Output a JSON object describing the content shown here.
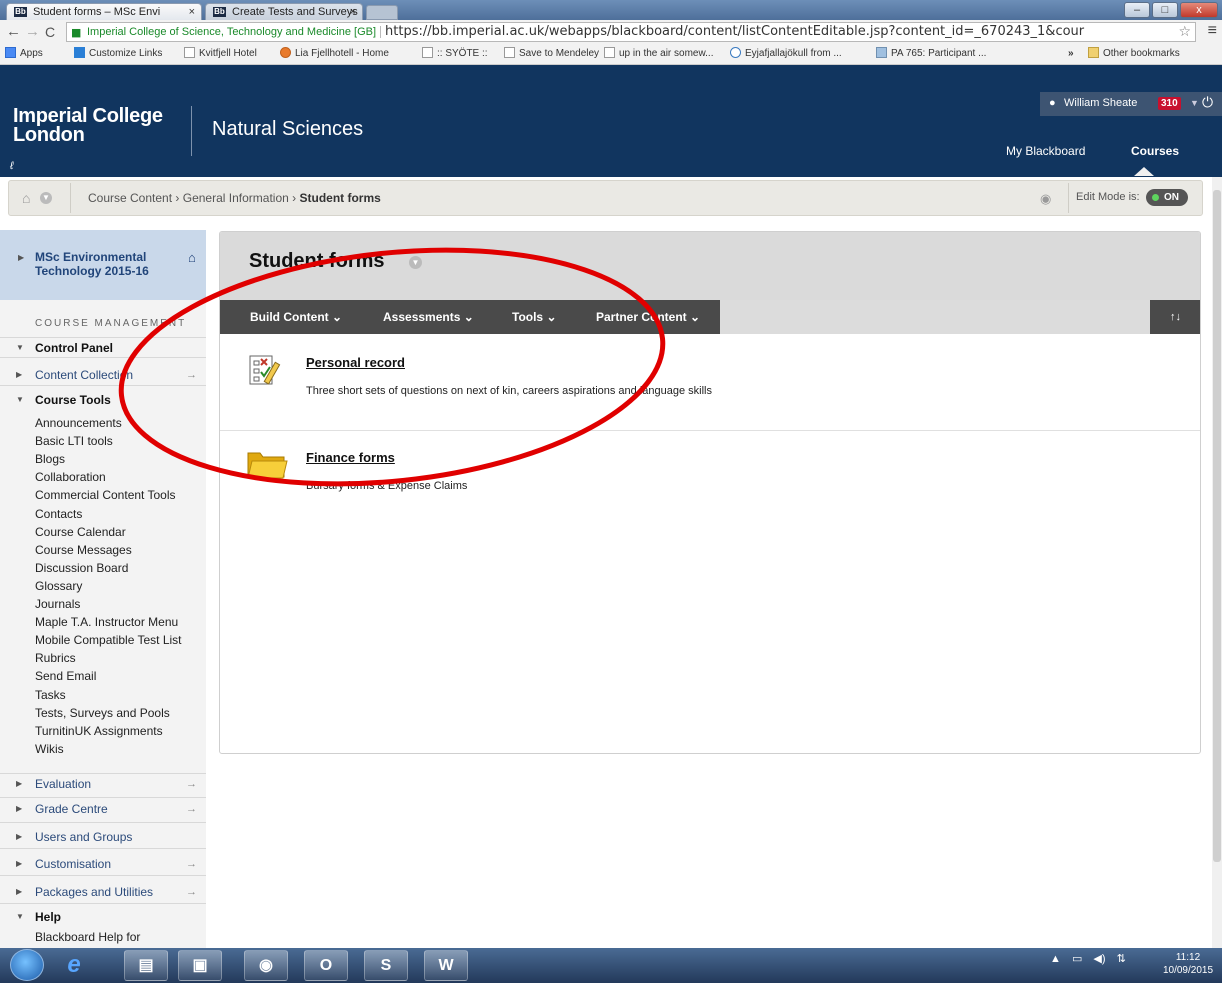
{
  "browser": {
    "tabs": [
      {
        "label": "Student forms – MSc Envi",
        "close": "×",
        "favicon": "Bb"
      },
      {
        "label": "Create Tests and Surveys",
        "close": "×",
        "favicon": "Bb"
      }
    ],
    "window_controls": {
      "minimize": "–",
      "maximize": "□",
      "close": "x"
    },
    "ev_label": "Imperial College of Science, Technology and Medicine [GB]",
    "url": "https://bb.imperial.ac.uk/webapps/blackboard/content/listContentEditable.jsp?content_id=_670243_1&cour",
    "bookmarks": [
      "Apps",
      "Customize Links",
      "Kvitfjell Hotel",
      "Lia Fjellhotell - Home",
      ":: SYÖTE ::",
      "Save to Mendeley",
      "up in the air somew...",
      "Eyjafjallajökull from ...",
      "PA 765: Participant ..."
    ],
    "bookmarks_overflow": "»",
    "other_bookmarks": "Other bookmarks"
  },
  "header": {
    "logo_line1": "Imperial College",
    "logo_line2": "London",
    "department": "Natural Sciences",
    "user_name": "William Sheate",
    "notification_count": "310",
    "nav": {
      "my_blackboard": "My Blackboard",
      "courses": "Courses"
    }
  },
  "breadcrumb": {
    "items": [
      "Course Content",
      "General Information"
    ],
    "separator": "›",
    "current": "Student forms",
    "edit_mode_label": "Edit Mode is:",
    "edit_mode_value": "ON"
  },
  "sidebar": {
    "course_name": "MSc Environmental Technology 2015-16",
    "section_label": "COURSE MANAGEMENT",
    "control_panel": "Control Panel",
    "content_collection": "Content Collection",
    "course_tools": "Course Tools",
    "tools": [
      "Announcements",
      "Basic LTI tools",
      "Blogs",
      "Collaboration",
      "Commercial Content Tools",
      "Contacts",
      "Course Calendar",
      "Course Messages",
      "Discussion Board",
      "Glossary",
      "Journals",
      "Maple T.A. Instructor Menu",
      "Mobile Compatible Test List",
      "Rubrics",
      "Send Email",
      "Tasks",
      "Tests, Surveys and Pools",
      "TurnitinUK Assignments",
      "Wikis"
    ],
    "sections": [
      "Evaluation",
      "Grade Centre",
      "Users and Groups",
      "Customisation",
      "Packages and Utilities"
    ],
    "help": "Help",
    "help_item": "Blackboard Help for"
  },
  "content": {
    "page_title": "Student forms",
    "actions": [
      "Build Content",
      "Assessments",
      "Tools",
      "Partner Content"
    ],
    "items": [
      {
        "title": "Personal record",
        "description": "Three short sets of questions on next of kin, careers aspirations and language skills"
      },
      {
        "title": "Finance forms",
        "description": "Bursary forms & Expense Claims"
      }
    ]
  },
  "taskbar": {
    "clock_time": "11:12",
    "clock_date": "10/09/2015"
  },
  "colors": {
    "header_bg": "#11355f",
    "course_tile": "#c9d8ea",
    "action_bar": "#4a4a4a",
    "annotation_ellipse": "#e00000",
    "notification_badge": "#c8102e"
  }
}
